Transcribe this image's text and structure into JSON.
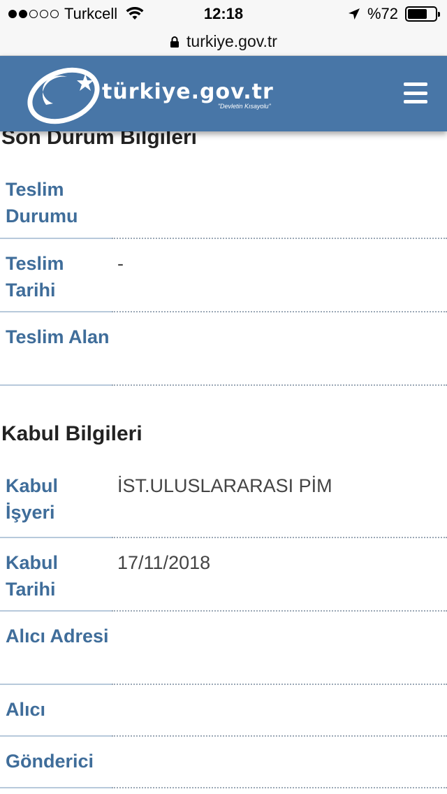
{
  "status_bar": {
    "carrier": "Turkcell",
    "time": "12:18",
    "battery": "%72",
    "battery_level": 0.72,
    "signal_bars_filled": 2,
    "signal_bars_total": 5
  },
  "browser": {
    "url": "turkiye.gov.tr"
  },
  "header": {
    "logo_text": "türkiye.gov.tr",
    "logo_slogan": "\"Devletin Kısayolu\"",
    "background": "#4876a7"
  },
  "sections": [
    {
      "title": "Son Durum Bilgileri",
      "rows": [
        {
          "label": "Teslim Durumu",
          "value": ""
        },
        {
          "label": "Teslim Tarihi",
          "value": "-"
        },
        {
          "label": "Teslim Alan",
          "value": ""
        }
      ]
    },
    {
      "title": "Kabul Bilgileri",
      "rows": [
        {
          "label": "Kabul İşyeri",
          "value": "İST.ULUSLARARASI PİM"
        },
        {
          "label": "Kabul Tarihi",
          "value": "17/11/2018"
        },
        {
          "label": "Alıcı Adresi",
          "value": ""
        },
        {
          "label": "Alıcı",
          "value": ""
        },
        {
          "label": "Gönderici",
          "value": ""
        }
      ]
    }
  ],
  "colors": {
    "label": "#3f6d9a",
    "accent": "#4876a7"
  }
}
